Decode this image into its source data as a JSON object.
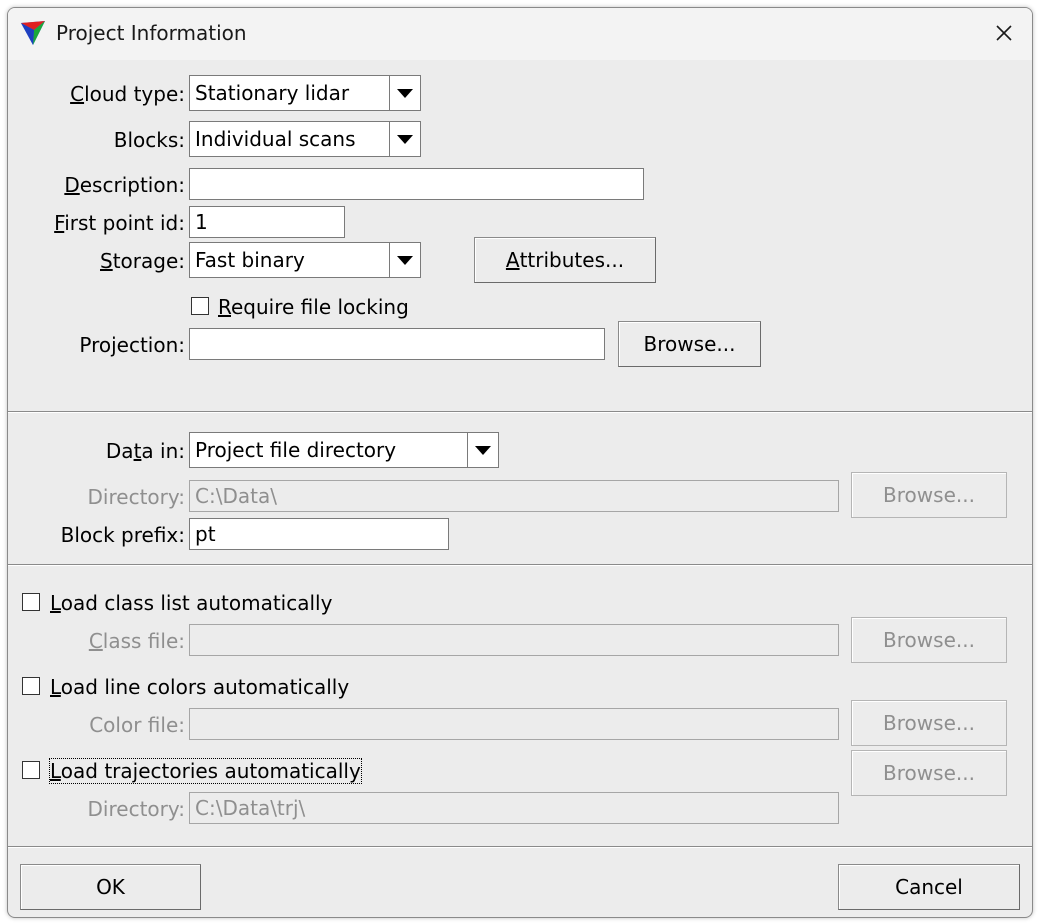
{
  "window": {
    "title": "Project Information",
    "close_glyph": "✕"
  },
  "project": {
    "cloud_type": {
      "label_u": "C",
      "label_rest": "loud type:",
      "value": "Stationary lidar"
    },
    "blocks": {
      "label": "Blocks:",
      "value": "Individual scans"
    },
    "description": {
      "label_u": "D",
      "label_rest": "escription:",
      "value": ""
    },
    "first_point_id": {
      "label_u": "F",
      "label_rest": "irst point id:",
      "value": "1"
    },
    "storage": {
      "label_u": "S",
      "label_rest": "torage:",
      "value": "Fast binary"
    },
    "attributes_button": {
      "label_u": "A",
      "label_rest": "ttributes..."
    },
    "require_locking": {
      "label_u": "R",
      "label_rest": "equire file locking",
      "checked": false
    },
    "projection": {
      "label": "Projection:",
      "value": "",
      "browse": "Browse..."
    }
  },
  "data": {
    "data_in": {
      "label_a": "Da",
      "label_u": "t",
      "label_b": "a in:",
      "value": "Project file directory"
    },
    "directory": {
      "label": "Directory:",
      "value": "C:\\Data\\",
      "browse": "Browse..."
    },
    "block_prefix": {
      "label": "Block prefix:",
      "value": "pt"
    }
  },
  "auto": {
    "class_list": {
      "label_u": "L",
      "label_rest": "oad class list automatically",
      "checked": false,
      "file_label_u": "C",
      "file_label_rest": "lass file:",
      "file_value": "",
      "browse": "Browse..."
    },
    "line_colors": {
      "label_u": "L",
      "label_rest": "oad line colors automatically",
      "checked": false,
      "file_label": "Color file:",
      "file_value": "",
      "browse": "Browse..."
    },
    "trajectories": {
      "label_u": "L",
      "label_rest": "oad trajectories automatically",
      "checked": false,
      "dir_label": "Directory:",
      "dir_value": "C:\\Data\\trj\\",
      "browse": "Browse..."
    }
  },
  "footer": {
    "ok": "OK",
    "cancel": "Cancel"
  },
  "colors": {
    "dialog_bg": "#ececec",
    "disabled_text": "#8f8f8f"
  },
  "icons": {
    "app": "terrasolid-triangle-icon",
    "close": "close-icon",
    "dropdown": "chevron-down-icon"
  }
}
